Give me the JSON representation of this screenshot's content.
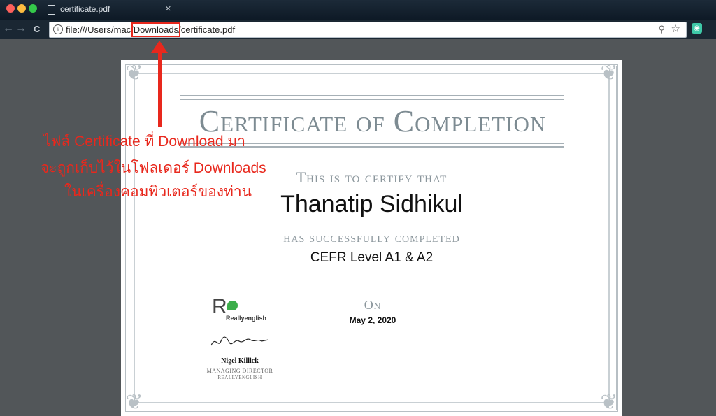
{
  "browser": {
    "tab_title": "certificate.pdf",
    "tab_close": "×",
    "nav_back": "←",
    "nav_forward": "→",
    "nav_reload": "C",
    "url_prefix": "file:///Users/mac/",
    "url_highlight": "Downloads",
    "url_suffix": "/certificate.pdf",
    "icons": [
      "info-icon",
      "zoom-icon",
      "star-icon",
      "extension-icon"
    ]
  },
  "certificate": {
    "title": "Certificate of Completion",
    "certify_line": "This is to certify that",
    "recipient": "Thanatip Sidhikul",
    "completed_line": "has successfully completed",
    "course": "CEFR Level A1 & A2",
    "on_label": "On",
    "date": "May  2, 2020",
    "logo_letter": "R",
    "logo_text": "Reallyenglish",
    "signer_name": "Nigel Killick",
    "signer_title": "MANAGING DIRECTOR",
    "signer_org": "REALLYENGLISH"
  },
  "annotation": {
    "line1": "ไฟล์ Certificate ที่ Download มา",
    "line2": "จะถูกเก็บไว้ในโฟลเดอร์ Downloads",
    "line3": "ในเครื่องคอมพิวเตอร์ของท่าน",
    "color": "#e8281d"
  },
  "colors": {
    "viewer_bg": "#525659",
    "title_gray": "#7d8b92",
    "logo_green": "#3cae4a"
  }
}
